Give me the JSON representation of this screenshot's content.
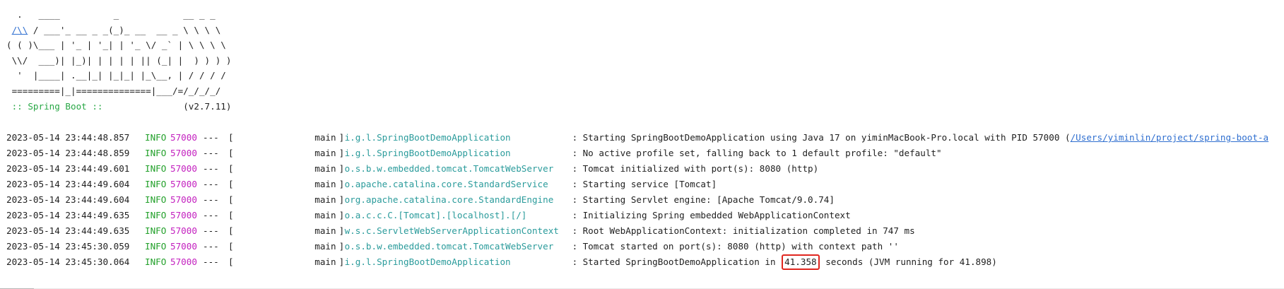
{
  "banner": {
    "l1": "  .   ____          _            __ _ _",
    "l2_pre": " ",
    "l2_link": "/\\\\",
    "l2_post": " / ___'_ __ _ _(_)_ __  __ _ \\ \\ \\ \\",
    "l3": "( ( )\\___ | '_ | '_| | '_ \\/ _` | \\ \\ \\ \\",
    "l4": " \\\\/  ___)| |_)| | | | | || (_| |  ) ) ) )",
    "l5": "  '  |____| .__|_| |_|_| |_\\__, | / / / /",
    "l6": " =========|_|==============|___/=/_/_/_/",
    "l7_label": " :: Spring Boot :: ",
    "l7_version": "              (v2.7.11)"
  },
  "log": [
    {
      "ts": "2023-05-14 23:44:48.857",
      "level": "INFO",
      "pid": "57000",
      "sep": "---",
      "thread": "main",
      "logger": "i.g.l.SpringBootDemoApplication",
      "msg": "Starting SpringBootDemoApplication using Java 17 on yiminMacBook-Pro.local with PID 57000 (",
      "link": "/Users/yiminlin/project/spring-boot-a"
    },
    {
      "ts": "2023-05-14 23:44:48.859",
      "level": "INFO",
      "pid": "57000",
      "sep": "---",
      "thread": "main",
      "logger": "i.g.l.SpringBootDemoApplication",
      "msg": "No active profile set, falling back to 1 default profile: \"default\""
    },
    {
      "ts": "2023-05-14 23:44:49.601",
      "level": "INFO",
      "pid": "57000",
      "sep": "---",
      "thread": "main",
      "logger": "o.s.b.w.embedded.tomcat.TomcatWebServer",
      "msg": "Tomcat initialized with port(s): 8080 (http)"
    },
    {
      "ts": "2023-05-14 23:44:49.604",
      "level": "INFO",
      "pid": "57000",
      "sep": "---",
      "thread": "main",
      "logger": "o.apache.catalina.core.StandardService",
      "msg": "Starting service [Tomcat]"
    },
    {
      "ts": "2023-05-14 23:44:49.604",
      "level": "INFO",
      "pid": "57000",
      "sep": "---",
      "thread": "main",
      "logger": "org.apache.catalina.core.StandardEngine",
      "msg": "Starting Servlet engine: [Apache Tomcat/9.0.74]"
    },
    {
      "ts": "2023-05-14 23:44:49.635",
      "level": "INFO",
      "pid": "57000",
      "sep": "---",
      "thread": "main",
      "logger": "o.a.c.c.C.[Tomcat].[localhost].[/]",
      "msg": "Initializing Spring embedded WebApplicationContext"
    },
    {
      "ts": "2023-05-14 23:44:49.635",
      "level": "INFO",
      "pid": "57000",
      "sep": "---",
      "thread": "main",
      "logger": "w.s.c.ServletWebServerApplicationContext",
      "msg": "Root WebApplicationContext: initialization completed in 747 ms"
    },
    {
      "ts": "2023-05-14 23:45:30.059",
      "level": "INFO",
      "pid": "57000",
      "sep": "---",
      "thread": "main",
      "logger": "o.s.b.w.embedded.tomcat.TomcatWebServer",
      "msg": "Tomcat started on port(s): 8080 (http) with context path ''"
    },
    {
      "ts": "2023-05-14 23:45:30.064",
      "level": "INFO",
      "pid": "57000",
      "sep": "---",
      "thread": "main",
      "logger": "i.g.l.SpringBootDemoApplication",
      "msg": "Started SpringBootDemoApplication in ",
      "highlight": "41.358",
      "msg_after": " seconds (JVM running for 41.898)"
    }
  ],
  "colors": {
    "level": "#22a02a",
    "pid": "#c31fbf",
    "logger": "#2a9b9b",
    "link": "#2f6fd0",
    "highlight_border": "#e0261f"
  }
}
